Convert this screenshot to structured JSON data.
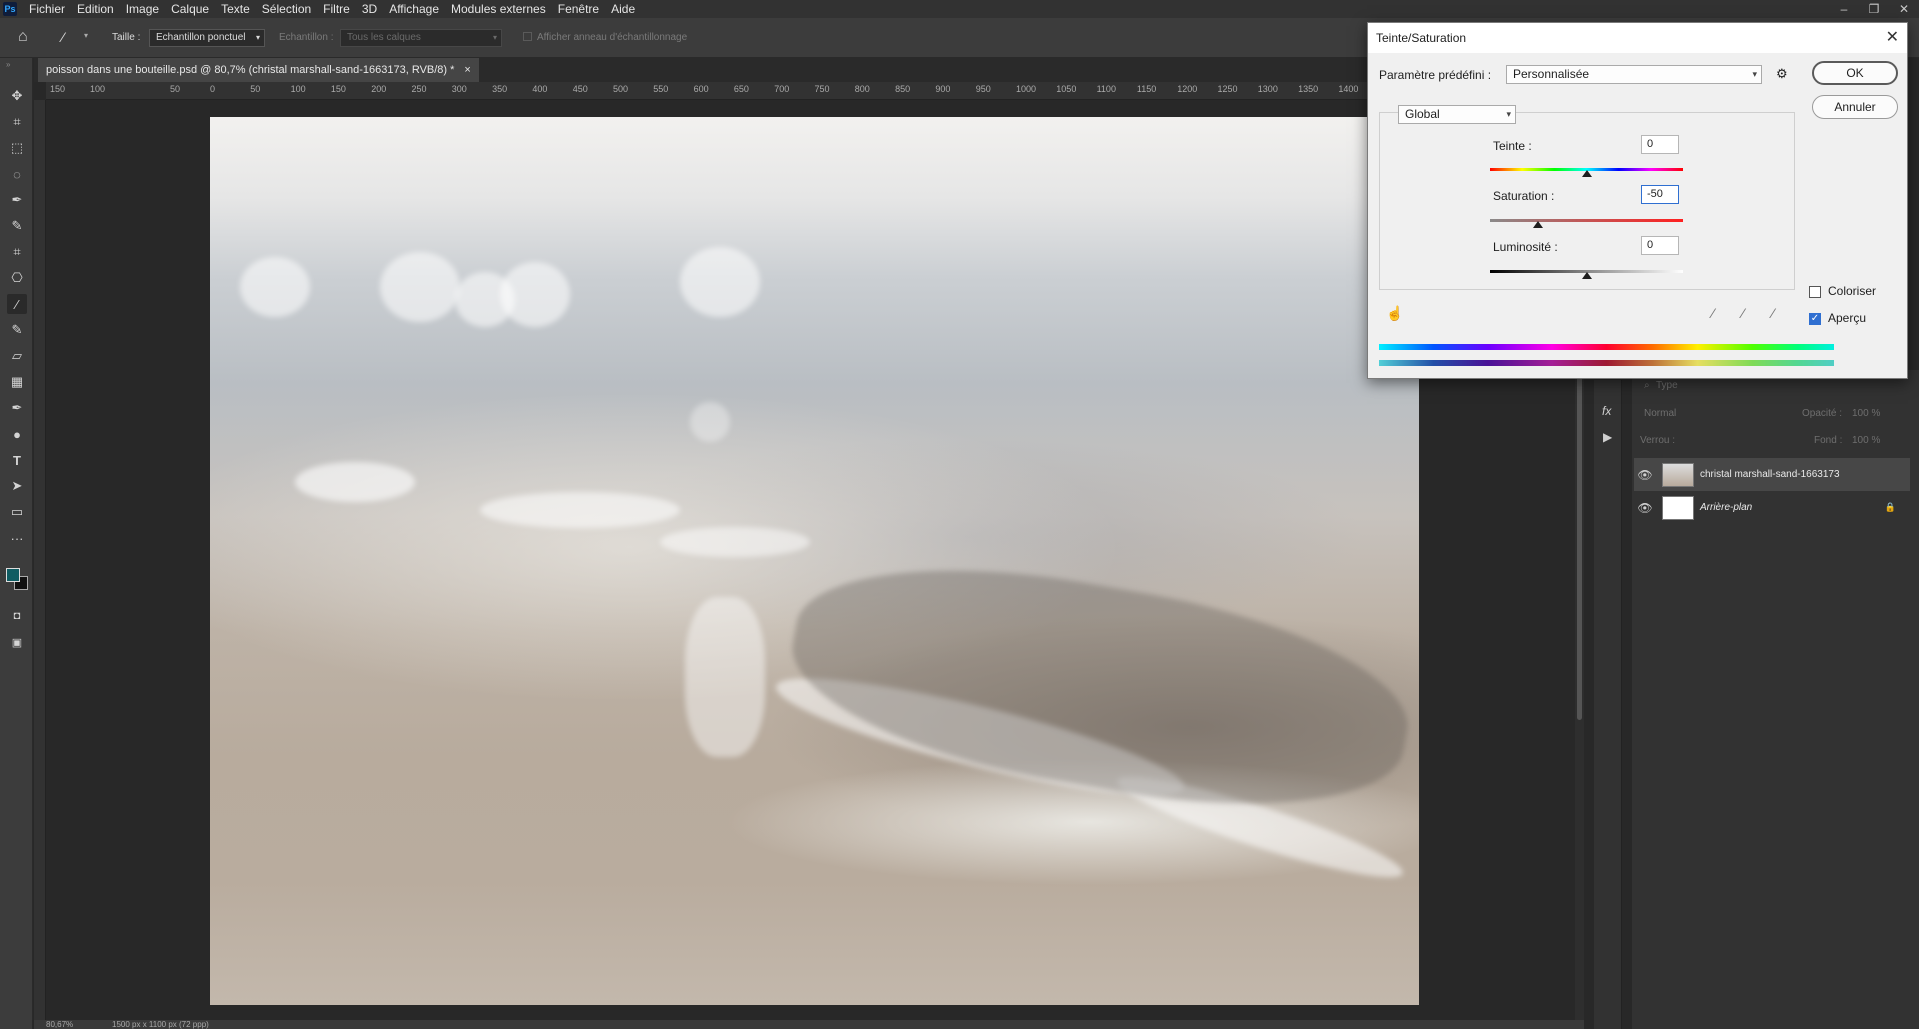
{
  "app": {
    "logo": "Ps"
  },
  "menu": [
    "Fichier",
    "Edition",
    "Image",
    "Calque",
    "Texte",
    "Sélection",
    "Filtre",
    "3D",
    "Affichage",
    "Modules externes",
    "Fenêtre",
    "Aide"
  ],
  "window_controls": {
    "minimize": "–",
    "restore": "❐",
    "close": "✕"
  },
  "options": {
    "size_label": "Taille :",
    "size_value": "Echantillon ponctuel",
    "sample_label": "Echantillon :",
    "sample_value": "Tous les calques",
    "ring_label": "Afficher anneau d'échantillonnage"
  },
  "document": {
    "tab_title": "poisson dans une bouteille.psd @ 80,7% (christal marshall-sand-1663173, RVB/8) *",
    "tab_close": "×",
    "zoom": "80,67%",
    "dimensions": "1500 px x 1100 px (72 ppp)"
  },
  "ruler_h": [
    "0",
    "50",
    "100",
    "150",
    "200",
    "250",
    "300",
    "350",
    "400",
    "450",
    "500",
    "550",
    "600",
    "650",
    "700",
    "750",
    "800",
    "850",
    "900",
    "950",
    "1000",
    "1050",
    "1100",
    "1150",
    "1200",
    "1250",
    "1300",
    "1350",
    "1400"
  ],
  "ruler_h_left": [
    "150",
    "100",
    "50"
  ],
  "layers_panel": {
    "search_placeholder": "Type",
    "blend_mode": "Normal",
    "opacity_label": "Opacité :",
    "opacity_value": "100 %",
    "lock_label": "Verrou :",
    "fill_label": "Fond :",
    "fill_value": "100 %",
    "layers": [
      {
        "name": "christal marshall-sand-1663173",
        "selected": true,
        "visible": true
      },
      {
        "name": "Arrière-plan",
        "selected": false,
        "visible": true,
        "locked": true
      }
    ]
  },
  "dialog": {
    "title": "Teinte/Saturation",
    "preset_label": "Paramètre prédéfini :",
    "preset_value": "Personnalisée",
    "channel": "Global",
    "ok": "OK",
    "cancel": "Annuler",
    "hue_label": "Teinte :",
    "hue_value": "0",
    "saturation_label": "Saturation :",
    "saturation_value": "-50",
    "lightness_label": "Luminosité :",
    "lightness_value": "0",
    "hue_level": 0.5,
    "saturation_level": 0.25,
    "lightness_level": 0.5,
    "colorize_label": "Coloriser",
    "colorize_checked": false,
    "preview_label": "Aperçu",
    "preview_checked": true
  },
  "icons": {
    "home": "⌂",
    "move": "✥",
    "crop": "⌗",
    "marquee": "⬚",
    "lasso": "◌",
    "pen": "✒",
    "brush": "✎",
    "stamp": "⎔",
    "eyedropper": "⁄",
    "eraser": "▱",
    "gradient": "▦",
    "dodge": "●",
    "type": "T",
    "path": "➤",
    "shape": "▭",
    "more": "···",
    "gear": "⚙",
    "hand": "☝",
    "eye": "👁",
    "lock": "🔒",
    "fx": "fx",
    "play": "▶"
  }
}
